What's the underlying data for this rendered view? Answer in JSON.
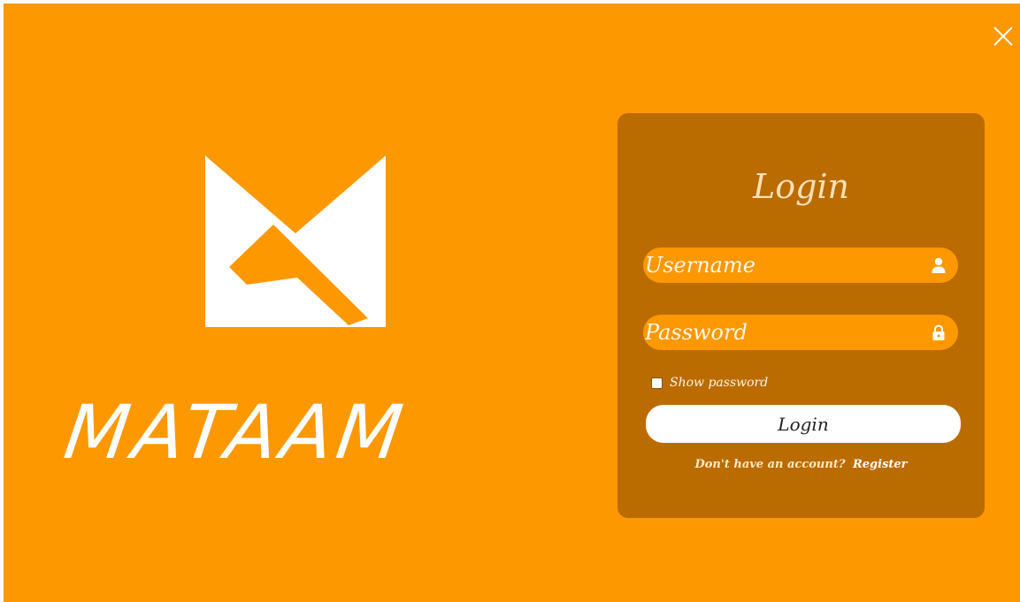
{
  "window": {
    "background_color": "#fd9801",
    "close_icon": "close-icon"
  },
  "brand": {
    "name": "MATAAM",
    "logo_icon": "mataam-logo-icon"
  },
  "login": {
    "title": "Login",
    "panel_color": "#bb6c01",
    "username": {
      "placeholder": "Username",
      "value": "",
      "icon": "user-icon"
    },
    "password": {
      "placeholder": "Password",
      "value": "",
      "icon": "lock-icon"
    },
    "show_password": {
      "label": "Show password",
      "checked": false
    },
    "submit_label": "Login",
    "register_prompt": "Don't have an account?",
    "register_link": "Register"
  }
}
